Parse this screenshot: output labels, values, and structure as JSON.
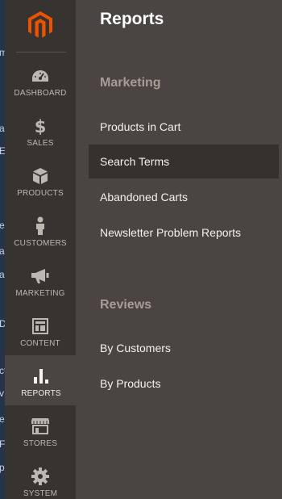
{
  "page_edge_fragments": [
    "m",
    "a",
    "E",
    "e",
    "a",
    "a",
    "DI",
    "ct",
    "v",
    "e",
    "F",
    "p"
  ],
  "nav": {
    "logo": "magento-logo-icon",
    "items": [
      {
        "label": "DASHBOARD",
        "icon": "dashboard-icon"
      },
      {
        "label": "SALES",
        "icon": "dollar-icon"
      },
      {
        "label": "PRODUCTS",
        "icon": "box-icon"
      },
      {
        "label": "CUSTOMERS",
        "icon": "person-icon"
      },
      {
        "label": "MARKETING",
        "icon": "megaphone-icon"
      },
      {
        "label": "CONTENT",
        "icon": "layout-icon"
      },
      {
        "label": "REPORTS",
        "icon": "bar-chart-icon",
        "active": true
      },
      {
        "label": "STORES",
        "icon": "storefront-icon"
      },
      {
        "label": "SYSTEM",
        "icon": "gear-icon"
      }
    ]
  },
  "submenu": {
    "title": "Reports",
    "sections": [
      {
        "title": "Marketing",
        "links": [
          "Products in Cart",
          "Search Terms",
          "Abandoned Carts",
          "Newsletter Problem Reports"
        ]
      },
      {
        "title": "Reviews",
        "links": [
          "By Customers",
          "By Products"
        ]
      }
    ],
    "hovered_link": "Search Terms"
  },
  "colors": {
    "rail": "#373330",
    "panel": "#4a4542",
    "accent": "#eb5202",
    "section_heading": "#a79d95"
  }
}
